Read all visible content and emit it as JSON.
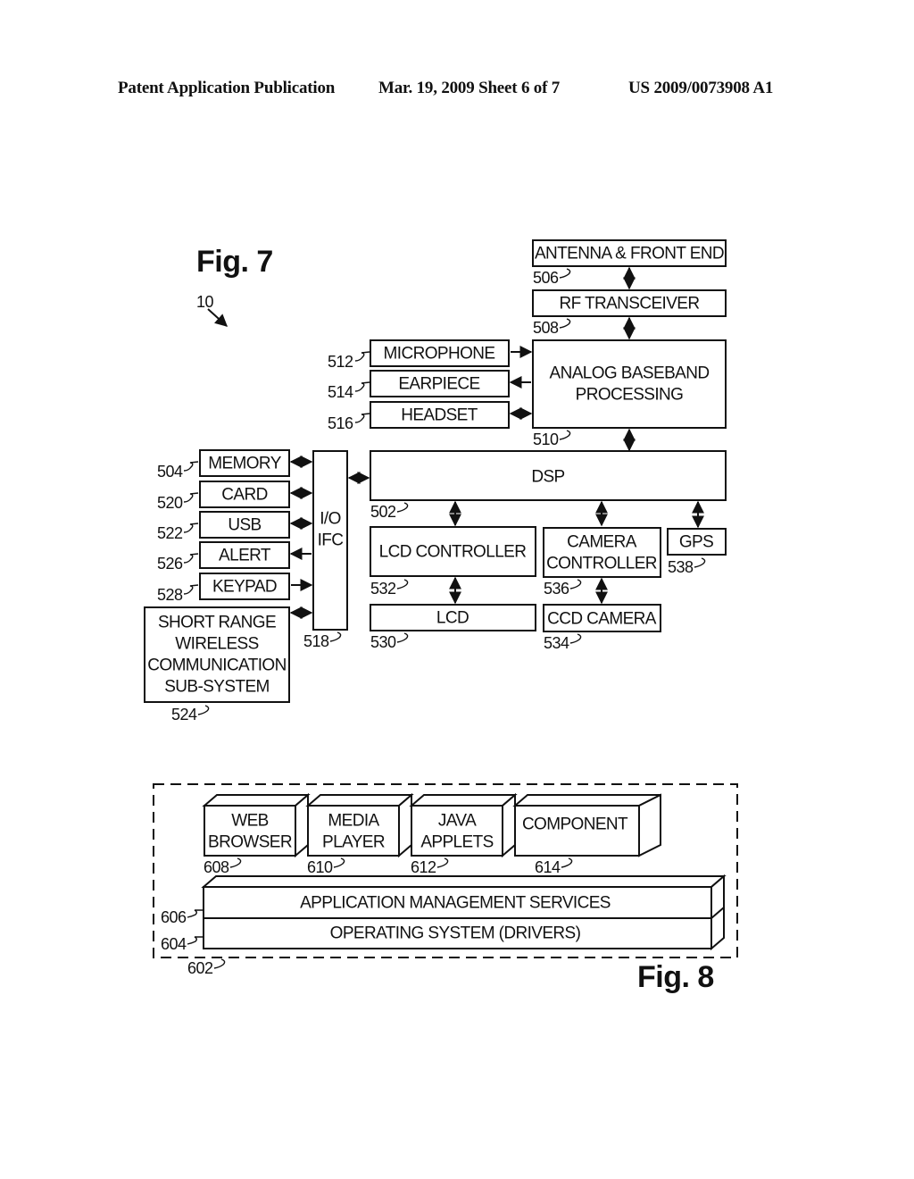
{
  "header": {
    "publication": "Patent Application Publication",
    "date_sheet": "Mar. 19, 2009  Sheet 6 of 7",
    "number": "US 2009/0073908 A1"
  },
  "fig7": {
    "title": "Fig. 7",
    "device_ref": "10",
    "blocks": {
      "antenna": {
        "label": "ANTENNA & FRONT END",
        "ref": "506"
      },
      "rf": {
        "label": "RF TRANSCEIVER",
        "ref": "508"
      },
      "abb": {
        "label1": "ANALOG BASEBAND",
        "label2": "PROCESSING",
        "ref": "510"
      },
      "microphone": {
        "label": "MICROPHONE",
        "ref": "512"
      },
      "earpiece": {
        "label": "EARPIECE",
        "ref": "514"
      },
      "headset": {
        "label": "HEADSET",
        "ref": "516"
      },
      "dsp": {
        "label": "DSP",
        "ref": "502"
      },
      "memory": {
        "label": "MEMORY",
        "ref": "504"
      },
      "card": {
        "label": "CARD",
        "ref": "520"
      },
      "usb": {
        "label": "USB",
        "ref": "522"
      },
      "alert": {
        "label": "ALERT",
        "ref": "526"
      },
      "keypad": {
        "label": "KEYPAD",
        "ref": "528"
      },
      "iofc": {
        "label1": "I/O",
        "label2": "IFC",
        "ref": "518"
      },
      "srw": {
        "label1": "SHORT RANGE",
        "label2": "WIRELESS",
        "label3": "COMMUNICATION",
        "label4": "SUB-SYSTEM",
        "ref": "524"
      },
      "lcdc": {
        "label": "LCD CONTROLLER",
        "ref": "532"
      },
      "lcd": {
        "label": "LCD",
        "ref": "530"
      },
      "camc": {
        "label1": "CAMERA",
        "label2": "CONTROLLER",
        "ref": "536"
      },
      "ccd": {
        "label": "CCD CAMERA",
        "ref": "534"
      },
      "gps": {
        "label": "GPS",
        "ref": "538"
      }
    }
  },
  "fig8": {
    "title": "Fig. 8",
    "container_ref": "602",
    "apps": [
      {
        "label1": "WEB",
        "label2": "BROWSER",
        "ref": "608"
      },
      {
        "label1": "MEDIA",
        "label2": "PLAYER",
        "ref": "610"
      },
      {
        "label1": "JAVA",
        "label2": "APPLETS",
        "ref": "612"
      },
      {
        "label1": "COMPONENT",
        "label2": "",
        "ref": "614"
      }
    ],
    "ams": {
      "label": "APPLICATION MANAGEMENT SERVICES",
      "ref": "606"
    },
    "os": {
      "label": "OPERATING SYSTEM (DRIVERS)",
      "ref": "604"
    }
  }
}
